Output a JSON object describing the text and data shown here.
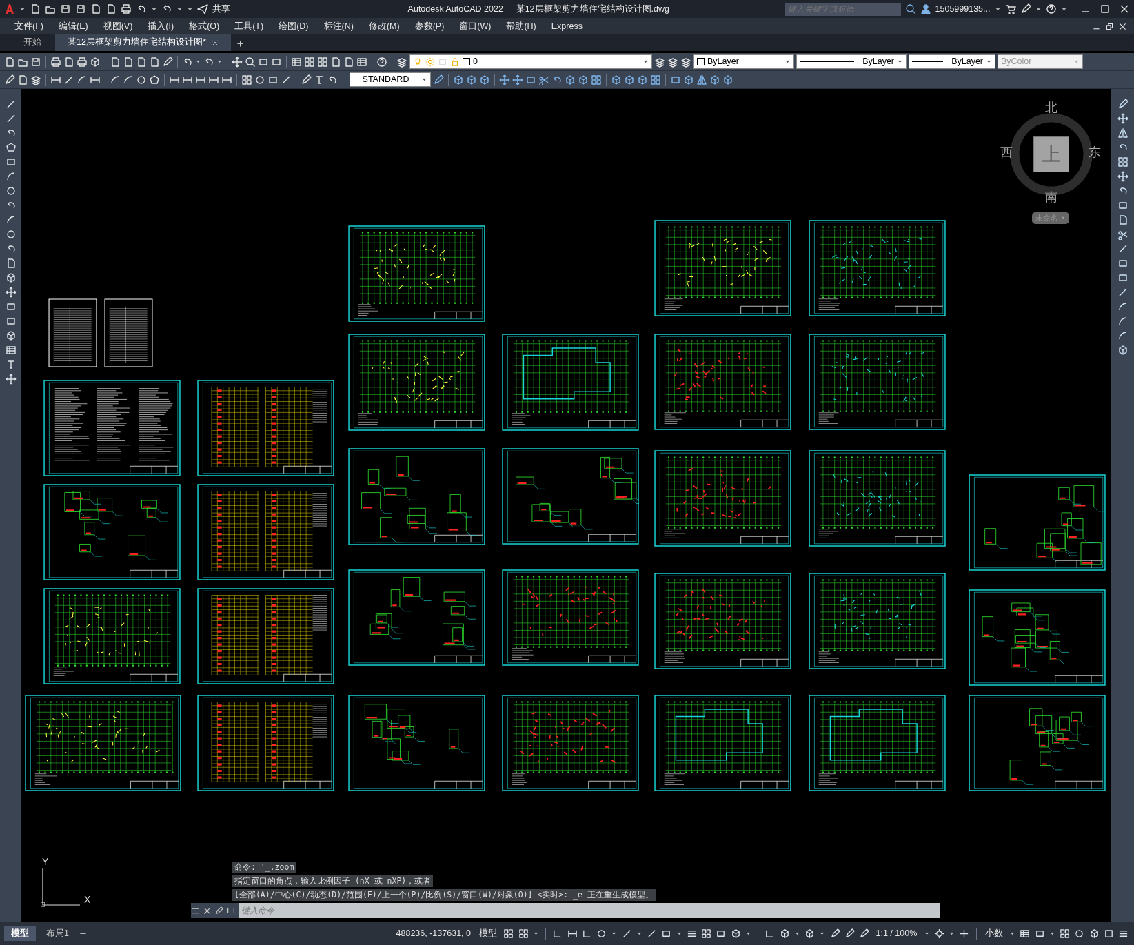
{
  "title_bar": {
    "share": "共享",
    "app": "Autodesk AutoCAD 2022",
    "file": "某12层框架剪力墙住宅结构设计图.dwg",
    "search": {
      "placeholder": "键入关键字或短语"
    },
    "user": "1505999135..."
  },
  "menu": [
    "文件(F)",
    "编辑(E)",
    "视图(V)",
    "插入(I)",
    "格式(O)",
    "工具(T)",
    "绘图(D)",
    "标注(N)",
    "修改(M)",
    "参数(P)",
    "窗口(W)",
    "帮助(H)",
    "Express"
  ],
  "file_tabs": [
    {
      "label": "开始",
      "selected": false
    },
    {
      "label": "某12层框架剪力墙住宅结构设计图*",
      "selected": true
    }
  ],
  "properties": {
    "layer": "0",
    "layer_color": "ByLayer",
    "linetype": "ByLayer",
    "lineweight": "ByLayer",
    "plot_style": {
      "value": "ByColor",
      "disabled": true
    }
  },
  "text_style": "STANDARD",
  "viewcube": {
    "north": "北",
    "south": "南",
    "west": "西",
    "east": "东",
    "face": "上",
    "ucs_menu": "未命名"
  },
  "ucs_icon": {
    "x": "X",
    "y": "Y"
  },
  "command_history": [
    "命令: '_.zoom",
    "指定窗口的角点，输入比例因子 (nX 或 nXP)，或者",
    "[全部(A)/中心(C)/动态(D)/范围(E)/上一个(P)/比例(S)/窗口(W)/对象(O)] <实时>: _e 正在重生成模型。"
  ],
  "command_line": {
    "placeholder": "键入命令"
  },
  "layout_tabs": [
    {
      "label": "模型",
      "selected": true
    },
    {
      "label": "布局1",
      "selected": false
    }
  ],
  "status_bar": {
    "coordinates": "488236, -137631, 0",
    "space": "模型",
    "annotation_scale": "1:1 / 100%",
    "units": "小数"
  }
}
